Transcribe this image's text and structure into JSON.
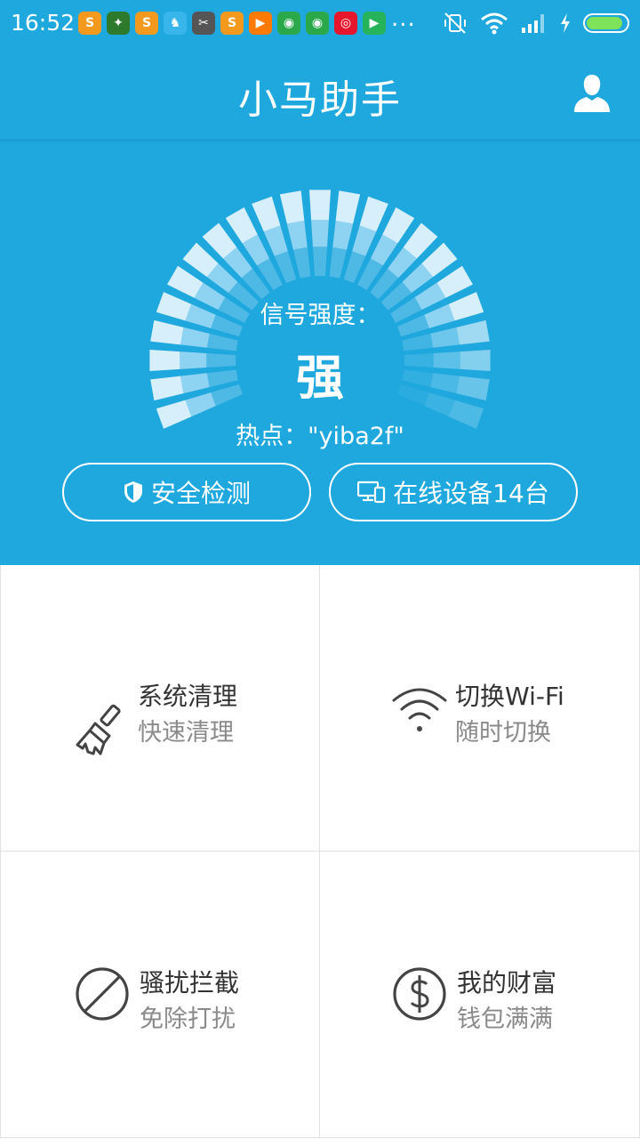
{
  "status_bar": {
    "time": "16:52",
    "more": "...",
    "notification_icons": [
      {
        "name": "sogou-icon",
        "glyph": "S",
        "color": "#f39a1e"
      },
      {
        "name": "app-icon",
        "glyph": "✦",
        "color": "#2d7a2d"
      },
      {
        "name": "sogou-icon",
        "glyph": "S",
        "color": "#f39a1e"
      },
      {
        "name": "horse-icon",
        "glyph": "♞",
        "color": "#38b6ec"
      },
      {
        "name": "app-icon",
        "glyph": "✂",
        "color": "#555555"
      },
      {
        "name": "sogou-icon",
        "glyph": "S",
        "color": "#f39a1e"
      },
      {
        "name": "video-icon",
        "glyph": "▶",
        "color": "#ff7a00"
      },
      {
        "name": "chrome-icon",
        "glyph": "◉",
        "color": "#2aa84a"
      },
      {
        "name": "chrome-icon",
        "glyph": "◉",
        "color": "#2aa84a"
      },
      {
        "name": "weibo-icon",
        "glyph": "◎",
        "color": "#e6162d"
      },
      {
        "name": "play-icon",
        "glyph": "▶",
        "color": "#27b35a"
      }
    ],
    "battery_level": 0.9
  },
  "header": {
    "title": "小马助手"
  },
  "signal": {
    "label": "信号强度：",
    "value": "强",
    "hotspot": "热点：\"yiba2f\""
  },
  "actions": {
    "security_label": "安全检测",
    "devices_label": "在线设备14台"
  },
  "grid": [
    {
      "id": "clean",
      "title": "系统清理",
      "subtitle": "快速清理"
    },
    {
      "id": "wifi",
      "title": "切换Wi-Fi",
      "subtitle": "随时切换"
    },
    {
      "id": "block",
      "title": "骚扰拦截",
      "subtitle": "免除打扰"
    },
    {
      "id": "wealth",
      "title": "我的财富",
      "subtitle": "钱包满满"
    }
  ],
  "colors": {
    "primary": "#1ea8de",
    "grid_bg": "#ffffff",
    "title_text": "#333333",
    "sub_text": "#8a8a8a",
    "battery_fill": "#7ee25a"
  }
}
